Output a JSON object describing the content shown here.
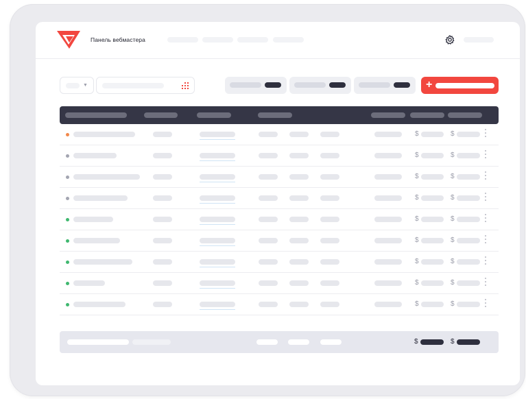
{
  "header": {
    "brand_text": "Панель вебмастера",
    "logo_icon": "red-triangle-v-logo",
    "settings_icon": "gear-icon"
  },
  "toolbar": {
    "select_icon": "chevron-down-icon",
    "search_icon": "grid-dots-icon",
    "add_button_icon": "plus-icon"
  },
  "table": {
    "currency_symbol": "$",
    "rows": [
      {
        "status": "orange"
      },
      {
        "status": "gray"
      },
      {
        "status": "gray"
      },
      {
        "status": "gray"
      },
      {
        "status": "green"
      },
      {
        "status": "green"
      },
      {
        "status": "green"
      },
      {
        "status": "green"
      },
      {
        "status": "green"
      }
    ]
  },
  "footer": {
    "currency_symbol": "$"
  },
  "colors": {
    "accent": "#f2473f",
    "header_bg": "#353646",
    "status_orange": "#f2884b",
    "status_gray": "#a3a5b1",
    "status_green": "#3fb86f"
  }
}
